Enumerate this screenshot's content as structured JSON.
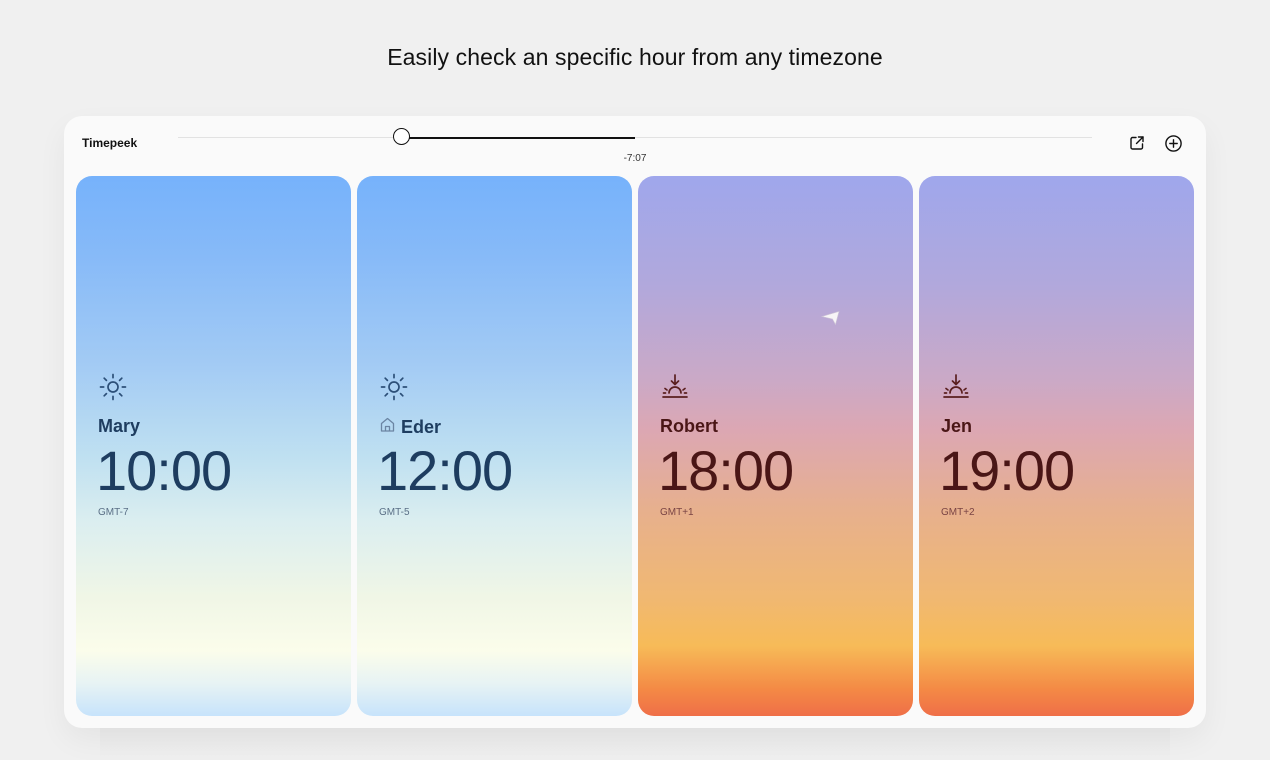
{
  "headline": "Easily check an specific hour from any timezone",
  "app": {
    "title": "Timepeek"
  },
  "slider": {
    "label": "-7:07",
    "thumb_fraction": 0.245,
    "fill_end_fraction": 0.5
  },
  "toolbar": {
    "share_icon": "external-link-icon",
    "add_icon": "plus-circle-icon"
  },
  "cards": [
    {
      "name": "Mary",
      "time": "10:00",
      "tz": "GMT-7",
      "theme": "day",
      "icon": "sun-icon",
      "home": false
    },
    {
      "name": "Eder",
      "time": "12:00",
      "tz": "GMT-5",
      "theme": "day",
      "icon": "sun-icon",
      "home": true
    },
    {
      "name": "Robert",
      "time": "18:00",
      "tz": "GMT+1",
      "theme": "dusk",
      "icon": "sunset-icon",
      "home": false
    },
    {
      "name": "Jen",
      "time": "19:00",
      "tz": "GMT+2",
      "theme": "dusk",
      "icon": "sunset-icon",
      "home": false
    }
  ],
  "colors": {
    "day_text": "#1e3d60",
    "dusk_text": "#4a1616",
    "sky_top": "#76b2fb",
    "dusk_top": "#9fa7ec",
    "dusk_bottom": "#ef6f48"
  }
}
